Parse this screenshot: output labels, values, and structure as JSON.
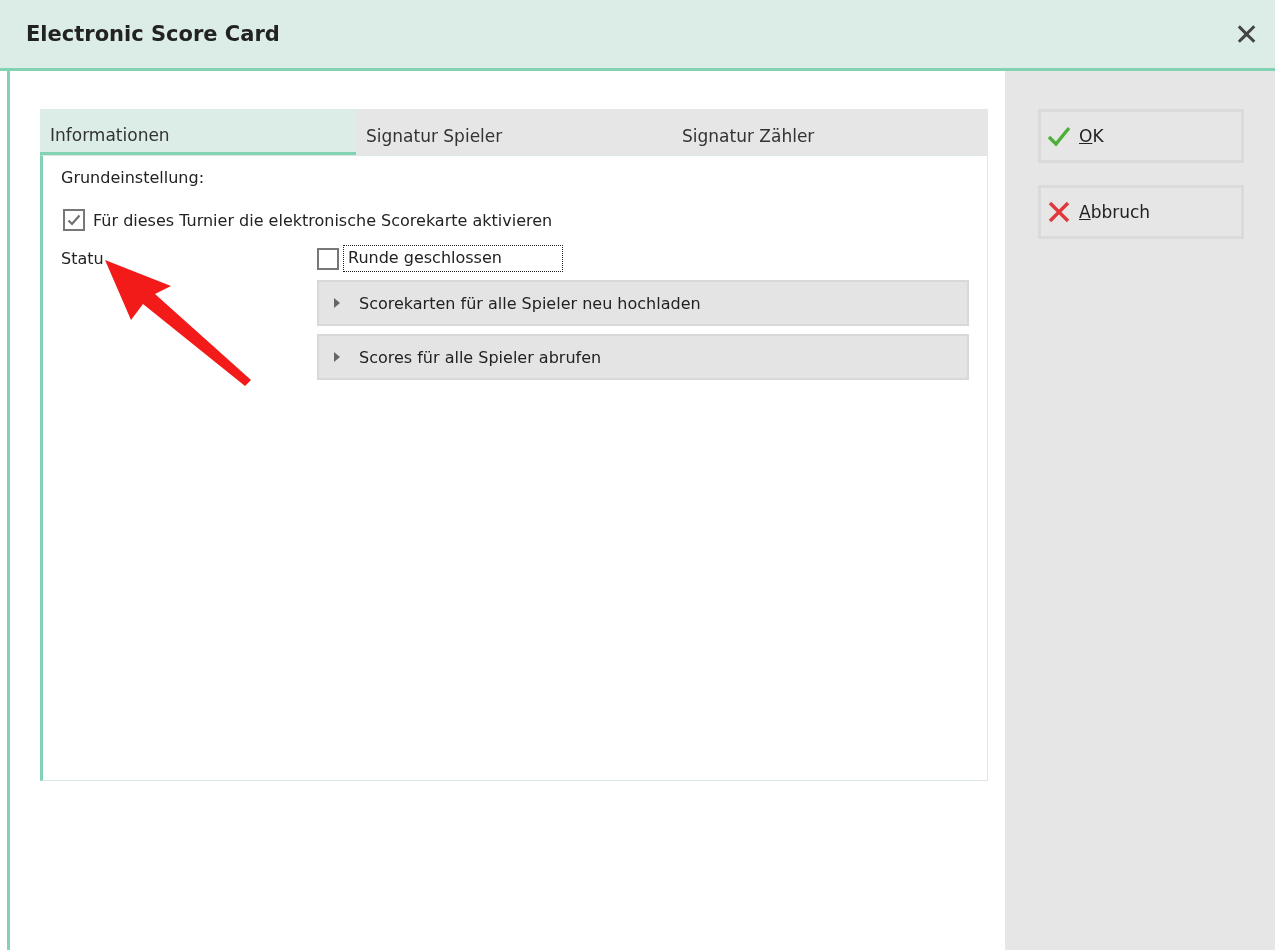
{
  "window": {
    "title": "Electronic Score Card",
    "close": "✕"
  },
  "tabs": [
    {
      "label": "Informationen",
      "selected": true
    },
    {
      "label": "Signatur Spieler",
      "selected": false
    },
    {
      "label": "Signatur Zähler",
      "selected": false
    }
  ],
  "section_label": "Grundeinstellung:",
  "activate": {
    "label": "Für dieses Turnier die elektronische Scorekarte aktivieren",
    "checked": true
  },
  "status_label": "Statu",
  "round_closed": {
    "label": "Runde geschlossen",
    "checked": false
  },
  "actions": [
    {
      "label": "Scorekarten für alle Spieler neu hochladen"
    },
    {
      "label": "Scores für alle Spieler abrufen"
    }
  ],
  "buttons": [
    {
      "label": "OK",
      "kind": "ok"
    },
    {
      "label": "Abbruch",
      "kind": "cancel"
    }
  ]
}
